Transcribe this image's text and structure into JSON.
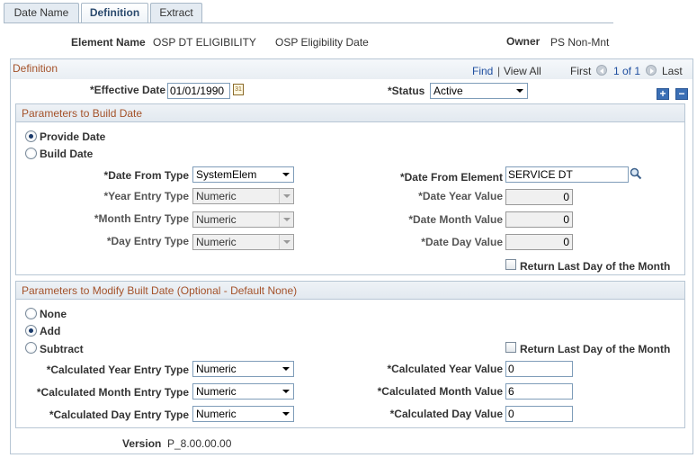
{
  "tabs": [
    {
      "label": "Date Name",
      "active": false
    },
    {
      "label": "Definition",
      "active": true
    },
    {
      "label": "Extract",
      "active": false
    }
  ],
  "header": {
    "element_name_label": "Element Name",
    "element_name_value": "OSP DT ELIGIBILITY",
    "element_desc": "OSP Eligibility Date",
    "owner_label": "Owner",
    "owner_value": "PS Non-Mnt"
  },
  "definition": {
    "title": "Definition",
    "find": "Find",
    "separator": "|",
    "view_all": "View All",
    "first": "First",
    "page_info": "1 of 1",
    "last": "Last",
    "effective_date_label": "*Effective Date",
    "effective_date_value": "01/01/1990",
    "status_label": "*Status",
    "status_value": "Active",
    "plus": "+",
    "minus": "−"
  },
  "build": {
    "title": "Parameters to Build Date",
    "provide_date": "Provide Date",
    "build_date": "Build Date",
    "selected": "Provide Date",
    "date_from_type_label": "*Date From Type",
    "date_from_type_value": "SystemElem",
    "year_entry_label": "*Year Entry Type",
    "year_entry_value": "Numeric",
    "month_entry_label": "*Month Entry Type",
    "month_entry_value": "Numeric",
    "day_entry_label": "*Day Entry Type",
    "day_entry_value": "Numeric",
    "date_from_element_label": "*Date From Element",
    "date_from_element_value": "SERVICE DT",
    "date_year_label": "*Date Year Value",
    "date_year_value": "0",
    "date_month_label": "*Date Month Value",
    "date_month_value": "0",
    "date_day_label": "*Date Day Value",
    "date_day_value": "0",
    "return_last_day": "Return Last Day of the Month",
    "return_last_day_checked": false
  },
  "modify": {
    "title": "Parameters to Modify Built Date (Optional - Default None)",
    "none": "None",
    "add": "Add",
    "subtract": "Subtract",
    "selected": "Add",
    "return_last_day": "Return Last Day of the Month",
    "return_last_day_checked": false,
    "calc_year_type_label": "*Calculated Year Entry Type",
    "calc_year_type_value": "Numeric",
    "calc_month_type_label": "*Calculated Month Entry Type",
    "calc_month_type_value": "Numeric",
    "calc_day_type_label": "*Calculated Day Entry Type",
    "calc_day_type_value": "Numeric",
    "calc_year_value_label": "*Calculated Year Value",
    "calc_year_value": "0",
    "calc_month_value_label": "*Calculated Month Value",
    "calc_month_value": "6",
    "calc_day_value_label": "*Calculated Day Value",
    "calc_day_value": "0"
  },
  "footer": {
    "version_label": "Version",
    "version_value": "P_8.00.00.00"
  }
}
